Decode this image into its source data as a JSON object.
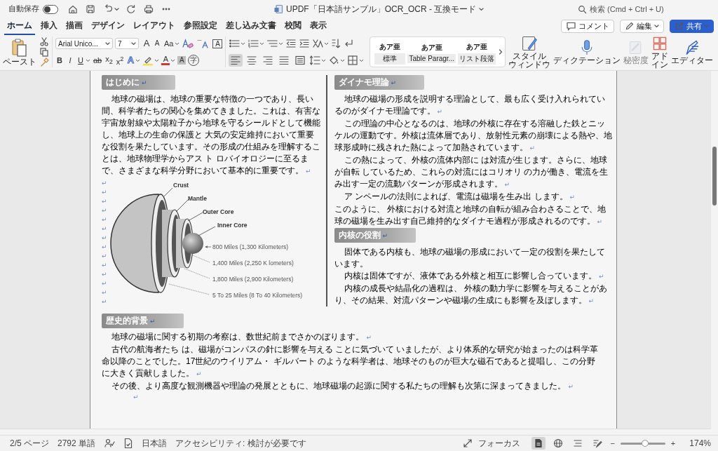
{
  "title_bar": {
    "autosave": {
      "label": "自動保存",
      "on": false
    },
    "title": "UPDF「日本語サンプル」OCR_OCR  -  互換モード",
    "search_placeholder": "検索 (Cmd + Ctrl + U)"
  },
  "ribbon_tabs": [
    {
      "label": "ホーム",
      "selected": true
    },
    {
      "label": "挿入",
      "selected": false
    },
    {
      "label": "描画",
      "selected": false
    },
    {
      "label": "デザイン",
      "selected": false
    },
    {
      "label": "レイアウト",
      "selected": false
    },
    {
      "label": "参照設定",
      "selected": false
    },
    {
      "label": "差し込み文書",
      "selected": false
    },
    {
      "label": "校閲",
      "selected": false
    },
    {
      "label": "表示",
      "selected": false
    }
  ],
  "ribbon_actions": [
    {
      "kind": "comment",
      "label": "コメント"
    },
    {
      "kind": "edit",
      "label": "編集"
    },
    {
      "kind": "share",
      "label": "共有"
    }
  ],
  "ribbon": {
    "paste_label": "ペースト",
    "font_name": "Arial Unico...",
    "font_size": "7",
    "font_row1": [
      {
        "kind": "grow",
        "label": "A"
      },
      {
        "kind": "shrink",
        "label": "A"
      },
      {
        "kind": "case",
        "label": "Aa",
        "dropdown": true
      },
      {
        "kind": "clear-format"
      },
      {
        "kind": "phonetic"
      },
      {
        "kind": "char-border",
        "label": "A"
      }
    ],
    "font_row2": [
      {
        "kind": "bold",
        "label": "B"
      },
      {
        "kind": "italic",
        "label": "I"
      },
      {
        "kind": "underline",
        "label": "U",
        "dropdown": true
      },
      {
        "kind": "strike",
        "label": "ab"
      },
      {
        "kind": "sub",
        "label": "x$_{2}$"
      },
      {
        "kind": "super",
        "label": "x$^{2}$"
      },
      {
        "kind": "text-effect",
        "label": "A",
        "dropdown": true
      },
      {
        "kind": "highlight",
        "dropdown": true
      },
      {
        "kind": "font-color",
        "label": "A",
        "dropdown": true
      },
      {
        "kind": "char-shading",
        "label": "A"
      },
      {
        "kind": "enclosed",
        "label": "字"
      }
    ],
    "para_row1": [
      {
        "kind": "bullets",
        "dropdown": true
      },
      {
        "kind": "numbering",
        "dropdown": true
      },
      {
        "kind": "multilevel",
        "dropdown": true
      },
      {
        "kind": "outdent"
      },
      {
        "kind": "indent"
      },
      {
        "kind": "asian-layout",
        "dropdown": true
      },
      {
        "kind": "sort"
      },
      {
        "kind": "marks"
      }
    ],
    "alignment": [
      {
        "kind": "align-left",
        "selected": true
      },
      {
        "kind": "align-center",
        "selected": false
      },
      {
        "kind": "align-right",
        "selected": false
      },
      {
        "kind": "justify",
        "selected": false
      },
      {
        "kind": "distributed",
        "selected": false
      }
    ],
    "para_row2": [
      {
        "kind": "line-spacing",
        "dropdown": true
      },
      {
        "kind": "shading",
        "dropdown": true
      },
      {
        "kind": "borders",
        "dropdown": true
      }
    ],
    "styles": [
      {
        "preview": "あア亜",
        "name": "標準"
      },
      {
        "preview": "あア亜",
        "name": "Table Paragr..."
      },
      {
        "preview": "あア亜",
        "name": "リスト段落"
      }
    ],
    "large_buttons": [
      {
        "kind": "styles-pane",
        "lines": [
          "スタイル",
          "ウィンドウ"
        ],
        "disabled": false
      },
      {
        "kind": "dictation",
        "lines": [
          "ディクテーション"
        ],
        "disabled": false
      },
      {
        "kind": "sensitivity",
        "lines": [
          "秘密度"
        ],
        "disabled": true
      },
      {
        "kind": "add-ins",
        "lines": [
          "アド",
          "イン"
        ],
        "disabled": false
      },
      {
        "kind": "editor",
        "lines": [
          "エディター"
        ],
        "disabled": false
      }
    ]
  },
  "document": {
    "left_column": {
      "heading": {
        "text": "はじめに",
        "mark": "↵"
      },
      "paragraphs": [
        {
          "text": "地球の磁場は、地球の重要な特徴の一つであり、長い間、科学者たちの関心を集めてきました。これは、有害な宇宙放射線や太陽粒子から地球を守るシールドとして機能し、地球上の生命の保護と 大気の安定維持において重要な役割を果たしています。その形成の仕組みを理解することは、地球物理学からアス ト ロバイオロジーに至るまで、さまざまな科学分野において基本的に重要です。",
          "mark": "↵",
          "indent": true
        }
      ],
      "blank_marks": [
        "↵",
        "↵",
        "↵",
        "↵",
        "↵",
        "↵",
        "↵",
        "↵",
        "↵",
        "↵",
        "↵",
        "↵",
        "↵",
        "↵"
      ],
      "diagram": {
        "layer_labels": [
          "Crust",
          "Mantle",
          "Outer Core",
          "Inner Core"
        ],
        "distance_labels": [
          "800 Miles (1,300 Kilometers)",
          "1,400 Miles (2,250 K lometers)",
          "1,800 Miles (2,900 Kilometers)",
          "5 To 25 Miles (8 To 40 Kilometers)"
        ]
      }
    },
    "right_column": [
      {
        "heading": {
          "text": "ダイナモ理論",
          "mark": "↵"
        },
        "paragraphs": [
          {
            "text": "地球の磁場の形成を説明する理論として、最も広く受け入れられているのがダイナモ理論です。",
            "mark": "↵",
            "indent": true
          },
          {
            "text": "この理論の中心となるのは、地球の外核に存在する溶融した鉄とニッケルの運動です。外核は流体層であり、放射性元素の崩壊による熱や、地球形成時に残された熱によって加熱されています。",
            "mark": "↵",
            "indent": true
          },
          {
            "text": "この熱によって、外核の流体内部に は対流が生じます。さらに、地球が自転 しているため、これらの対流にはコリオリ の力が働き、電流を生み出す一定の流動パターンが形成されます。",
            "mark": "↵",
            "indent": true
          },
          {
            "text": "ア ンペールの法則によれば、電流は磁場を生み出 します。",
            "mark": "↵",
            "indent": true
          },
          {
            "text": "このように、 外核における対流と地球の自転が組み合わさることで、地球の磁場を生み出す自己維持的なダイナモ過程が形成されるのです。",
            "mark": "↵",
            "indent": false
          }
        ]
      },
      {
        "heading": {
          "text": "内核の役割",
          "mark": "↵"
        },
        "paragraphs": [
          {
            "text": "固体である内核も、地球の磁場の形成において一定の役割を果たしています。",
            "indent": true
          },
          {
            "text": "内核は固体ですが、液体である外核と相互に影響し合っています。",
            "mark": "↵",
            "indent": true
          },
          {
            "text": "内核の成長や結晶化の過程は、 外核の動力学に影響を与えることがあり、その結果、対流パターンや磁場の生成にも影響を及ぼします。",
            "mark": "↵",
            "indent": true
          }
        ]
      }
    ],
    "full_width": {
      "heading": {
        "text": "歴史的背景",
        "mark": "↵"
      },
      "paragraphs": [
        {
          "text": "地球の磁場に関する初期の考察は、数世紀前までさかのぼります。",
          "mark": "↵",
          "indent": true
        },
        {
          "text": "古代の航海者たち は、磁場がコンパスの針に影響を与える ことに気づいて いましたが、より体系的な研究が始まったのは科学革命以降のことでした。17世紀のウイリアム・ ギルバート のような科学者は、地球そのものが巨大な磁石であると提唱し、この分野に大きく貢献しました。",
          "mark": "↵",
          "indent": true
        },
        {
          "text": "その後、より高度な観測機器や理論の発展とともに、地球磁場の起源に関する私たちの理解も次第に深まってきました。",
          "mark": "↵",
          "indent": true
        }
      ],
      "trailing_mark": "↵"
    }
  },
  "status_bar": {
    "items": [
      {
        "kind": "page",
        "label": "2/5 ページ"
      },
      {
        "kind": "words",
        "label": "2792 単語"
      },
      {
        "kind": "proofing"
      },
      {
        "kind": "doc-stats"
      },
      {
        "kind": "language",
        "label": "日本語"
      },
      {
        "kind": "accessibility",
        "label": "アクセシビリティ: 検討が必要です"
      }
    ],
    "focus": "フォーカス",
    "views": [
      {
        "kind": "print-layout",
        "selected": true
      },
      {
        "kind": "web-layout",
        "selected": false
      },
      {
        "kind": "outline",
        "selected": false
      },
      {
        "kind": "draft",
        "selected": false
      }
    ],
    "zoom": {
      "minus": "−",
      "plus": "+",
      "level": 0.55,
      "reading": "174%"
    }
  }
}
